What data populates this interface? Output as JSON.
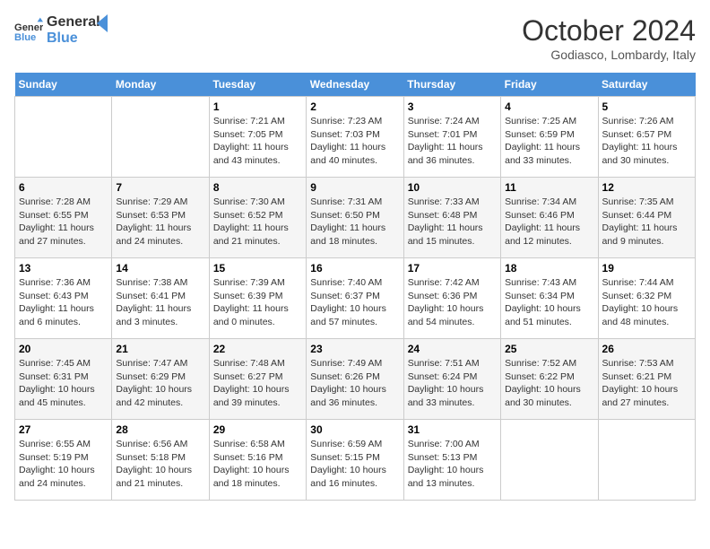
{
  "header": {
    "logo_line1": "General",
    "logo_line2": "Blue",
    "title": "October 2024",
    "subtitle": "Godiasco, Lombardy, Italy"
  },
  "calendar": {
    "days_of_week": [
      "Sunday",
      "Monday",
      "Tuesday",
      "Wednesday",
      "Thursday",
      "Friday",
      "Saturday"
    ],
    "weeks": [
      [
        {
          "day": "",
          "info": ""
        },
        {
          "day": "",
          "info": ""
        },
        {
          "day": "1",
          "info": "Sunrise: 7:21 AM\nSunset: 7:05 PM\nDaylight: 11 hours and 43 minutes."
        },
        {
          "day": "2",
          "info": "Sunrise: 7:23 AM\nSunset: 7:03 PM\nDaylight: 11 hours and 40 minutes."
        },
        {
          "day": "3",
          "info": "Sunrise: 7:24 AM\nSunset: 7:01 PM\nDaylight: 11 hours and 36 minutes."
        },
        {
          "day": "4",
          "info": "Sunrise: 7:25 AM\nSunset: 6:59 PM\nDaylight: 11 hours and 33 minutes."
        },
        {
          "day": "5",
          "info": "Sunrise: 7:26 AM\nSunset: 6:57 PM\nDaylight: 11 hours and 30 minutes."
        }
      ],
      [
        {
          "day": "6",
          "info": "Sunrise: 7:28 AM\nSunset: 6:55 PM\nDaylight: 11 hours and 27 minutes."
        },
        {
          "day": "7",
          "info": "Sunrise: 7:29 AM\nSunset: 6:53 PM\nDaylight: 11 hours and 24 minutes."
        },
        {
          "day": "8",
          "info": "Sunrise: 7:30 AM\nSunset: 6:52 PM\nDaylight: 11 hours and 21 minutes."
        },
        {
          "day": "9",
          "info": "Sunrise: 7:31 AM\nSunset: 6:50 PM\nDaylight: 11 hours and 18 minutes."
        },
        {
          "day": "10",
          "info": "Sunrise: 7:33 AM\nSunset: 6:48 PM\nDaylight: 11 hours and 15 minutes."
        },
        {
          "day": "11",
          "info": "Sunrise: 7:34 AM\nSunset: 6:46 PM\nDaylight: 11 hours and 12 minutes."
        },
        {
          "day": "12",
          "info": "Sunrise: 7:35 AM\nSunset: 6:44 PM\nDaylight: 11 hours and 9 minutes."
        }
      ],
      [
        {
          "day": "13",
          "info": "Sunrise: 7:36 AM\nSunset: 6:43 PM\nDaylight: 11 hours and 6 minutes."
        },
        {
          "day": "14",
          "info": "Sunrise: 7:38 AM\nSunset: 6:41 PM\nDaylight: 11 hours and 3 minutes."
        },
        {
          "day": "15",
          "info": "Sunrise: 7:39 AM\nSunset: 6:39 PM\nDaylight: 11 hours and 0 minutes."
        },
        {
          "day": "16",
          "info": "Sunrise: 7:40 AM\nSunset: 6:37 PM\nDaylight: 10 hours and 57 minutes."
        },
        {
          "day": "17",
          "info": "Sunrise: 7:42 AM\nSunset: 6:36 PM\nDaylight: 10 hours and 54 minutes."
        },
        {
          "day": "18",
          "info": "Sunrise: 7:43 AM\nSunset: 6:34 PM\nDaylight: 10 hours and 51 minutes."
        },
        {
          "day": "19",
          "info": "Sunrise: 7:44 AM\nSunset: 6:32 PM\nDaylight: 10 hours and 48 minutes."
        }
      ],
      [
        {
          "day": "20",
          "info": "Sunrise: 7:45 AM\nSunset: 6:31 PM\nDaylight: 10 hours and 45 minutes."
        },
        {
          "day": "21",
          "info": "Sunrise: 7:47 AM\nSunset: 6:29 PM\nDaylight: 10 hours and 42 minutes."
        },
        {
          "day": "22",
          "info": "Sunrise: 7:48 AM\nSunset: 6:27 PM\nDaylight: 10 hours and 39 minutes."
        },
        {
          "day": "23",
          "info": "Sunrise: 7:49 AM\nSunset: 6:26 PM\nDaylight: 10 hours and 36 minutes."
        },
        {
          "day": "24",
          "info": "Sunrise: 7:51 AM\nSunset: 6:24 PM\nDaylight: 10 hours and 33 minutes."
        },
        {
          "day": "25",
          "info": "Sunrise: 7:52 AM\nSunset: 6:22 PM\nDaylight: 10 hours and 30 minutes."
        },
        {
          "day": "26",
          "info": "Sunrise: 7:53 AM\nSunset: 6:21 PM\nDaylight: 10 hours and 27 minutes."
        }
      ],
      [
        {
          "day": "27",
          "info": "Sunrise: 6:55 AM\nSunset: 5:19 PM\nDaylight: 10 hours and 24 minutes."
        },
        {
          "day": "28",
          "info": "Sunrise: 6:56 AM\nSunset: 5:18 PM\nDaylight: 10 hours and 21 minutes."
        },
        {
          "day": "29",
          "info": "Sunrise: 6:58 AM\nSunset: 5:16 PM\nDaylight: 10 hours and 18 minutes."
        },
        {
          "day": "30",
          "info": "Sunrise: 6:59 AM\nSunset: 5:15 PM\nDaylight: 10 hours and 16 minutes."
        },
        {
          "day": "31",
          "info": "Sunrise: 7:00 AM\nSunset: 5:13 PM\nDaylight: 10 hours and 13 minutes."
        },
        {
          "day": "",
          "info": ""
        },
        {
          "day": "",
          "info": ""
        }
      ]
    ]
  }
}
